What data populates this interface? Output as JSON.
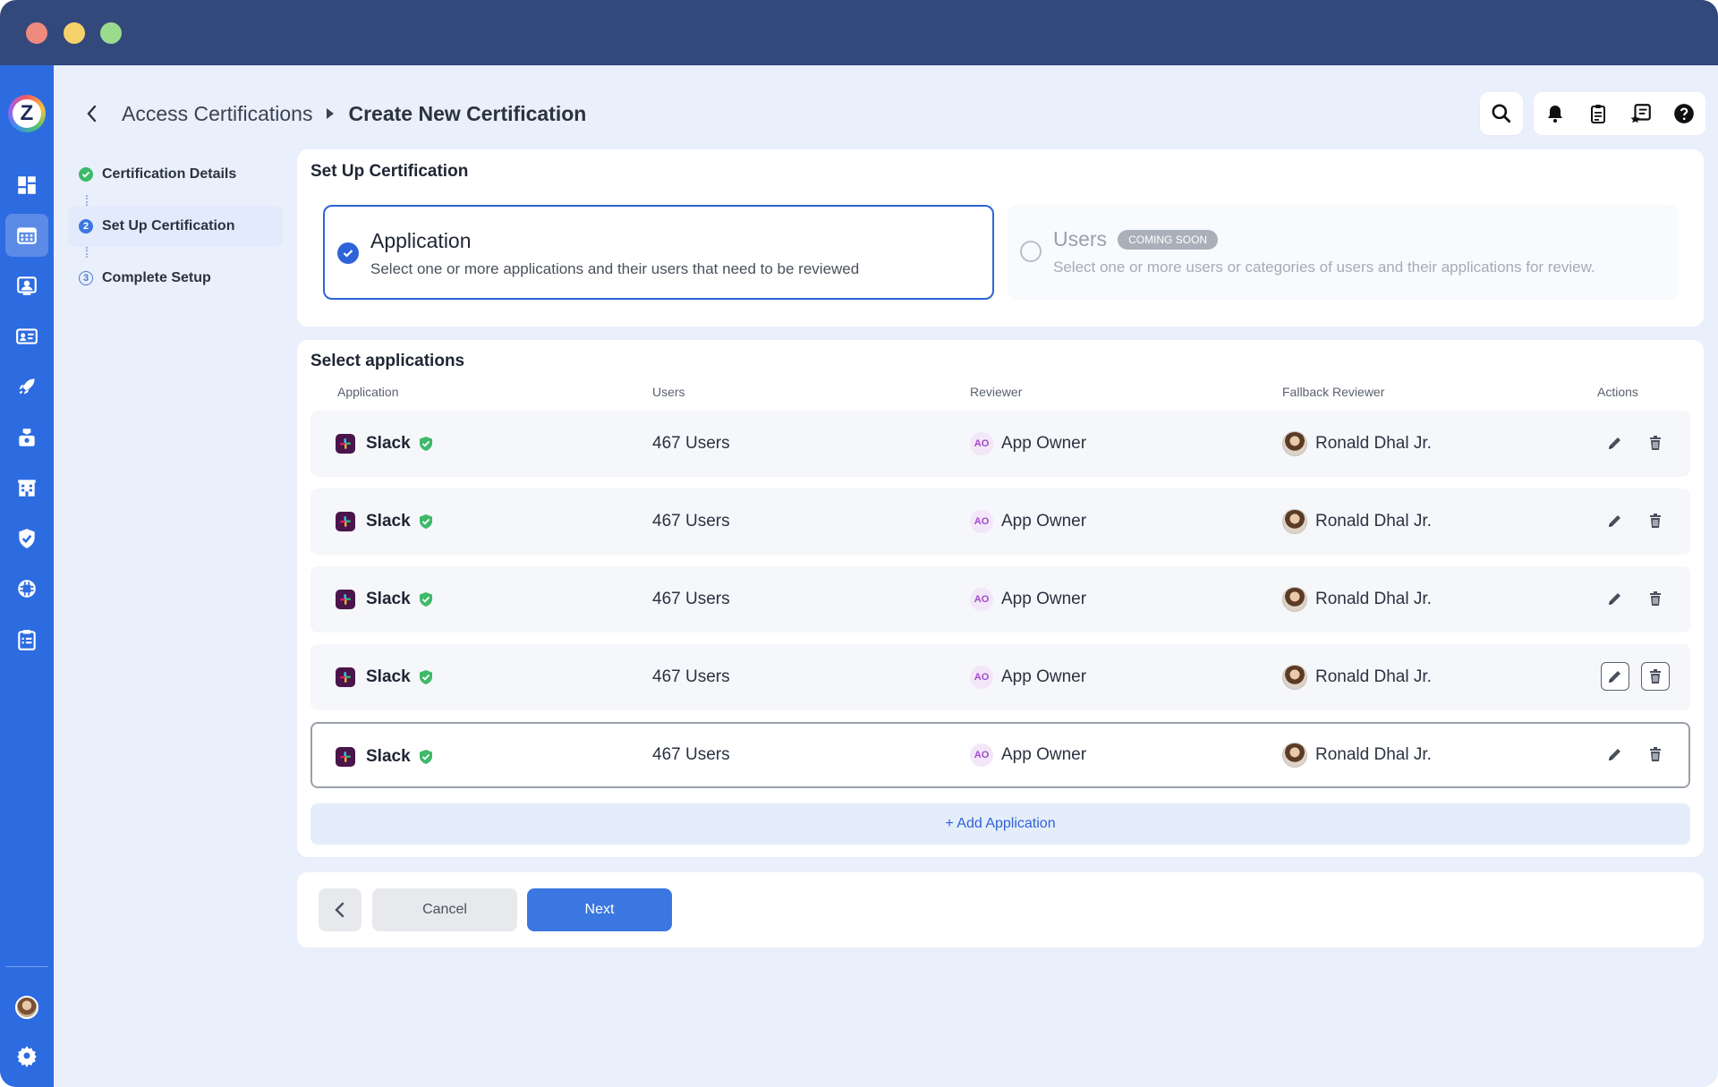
{
  "breadcrumb": {
    "parent": "Access Certifications",
    "current": "Create New Certification"
  },
  "steps": [
    {
      "label": "Certification Details",
      "status": "done",
      "marker": ""
    },
    {
      "label": "Set Up Certification",
      "status": "current",
      "marker": "2"
    },
    {
      "label": "Complete Setup",
      "status": "pending",
      "marker": "3"
    }
  ],
  "setup": {
    "title": "Set Up Certification",
    "application": {
      "title": "Application",
      "description": "Select one or more applications and their users that need to be reviewed",
      "selected": true
    },
    "users": {
      "title": "Users",
      "badge": "COMING SOON",
      "description": "Select one or more users or categories of users and their applications for review.",
      "selected": false
    }
  },
  "apps": {
    "title": "Select applications",
    "columns": [
      "Application",
      "Users",
      "Reviewer",
      "Fallback Reviewer",
      "Actions"
    ],
    "rows": [
      {
        "app": "Slack",
        "users": "467 Users",
        "reviewer_initials": "AO",
        "reviewer": "App Owner",
        "fallback": "Ronald Dhal Jr."
      },
      {
        "app": "Slack",
        "users": "467 Users",
        "reviewer_initials": "AO",
        "reviewer": "App Owner",
        "fallback": "Ronald Dhal Jr."
      },
      {
        "app": "Slack",
        "users": "467 Users",
        "reviewer_initials": "AO",
        "reviewer": "App Owner",
        "fallback": "Ronald Dhal Jr."
      },
      {
        "app": "Slack",
        "users": "467 Users",
        "reviewer_initials": "AO",
        "reviewer": "App Owner",
        "fallback": "Ronald Dhal Jr."
      },
      {
        "app": "Slack",
        "users": "467 Users",
        "reviewer_initials": "AO",
        "reviewer": "App Owner",
        "fallback": "Ronald Dhal Jr."
      }
    ],
    "add_label": "+ Add Application"
  },
  "footer": {
    "cancel_label": "Cancel",
    "next_label": "Next"
  },
  "icons": {
    "rail": [
      "dashboard-icon",
      "calendar-icon",
      "user-card-icon",
      "id-card-icon",
      "rocket-icon",
      "badge-icon",
      "building-icon",
      "shield-check-icon",
      "chip-icon",
      "clipboard-icon"
    ],
    "top_actions": [
      "search-icon",
      "bell-icon",
      "clipboard-icon",
      "review-icon",
      "help-icon"
    ]
  },
  "colors": {
    "titlebar": "#33497c",
    "rail": "#2d6be0",
    "accent": "#2f63d8",
    "verified": "#3fb96a",
    "slack": "#4a154b"
  }
}
